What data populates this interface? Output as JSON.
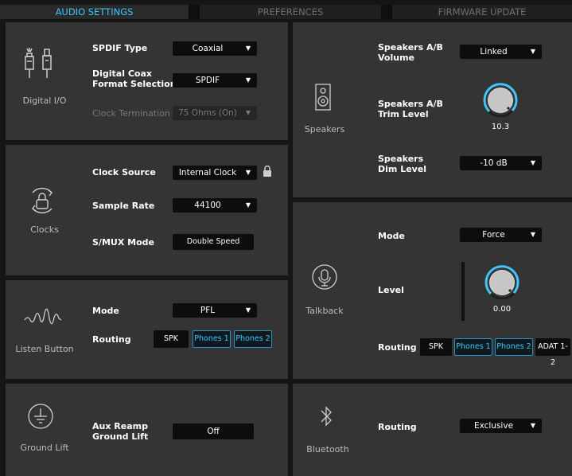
{
  "tabs": [
    {
      "label": "AUDIO SETTINGS",
      "active": true
    },
    {
      "label": "PREFERENCES",
      "active": false
    },
    {
      "label": "FIRMWARE UPDATE",
      "active": false
    }
  ],
  "digital_io": {
    "section_label": "Digital I/O",
    "spdif_type_label": "SPDIF Type",
    "spdif_type_value": "Coaxial",
    "coax_format_label": "Digital Coax\nFormat Selection",
    "coax_format_value": "SPDIF",
    "clock_termination_label": "Clock Termination",
    "clock_termination_value": "75 Ohms (On)"
  },
  "clocks": {
    "section_label": "Clocks",
    "clock_source_label": "Clock Source",
    "clock_source_value": "Internal Clock",
    "sample_rate_label": "Sample Rate",
    "sample_rate_value": "44100",
    "smux_label": "S/MUX Mode",
    "smux_value": "Double Speed"
  },
  "listen": {
    "section_label": "Listen Button",
    "mode_label": "Mode",
    "mode_value": "PFL",
    "routing_label": "Routing",
    "routing": [
      {
        "label": "SPK",
        "selected": false
      },
      {
        "label": "Phones 1",
        "selected": true
      },
      {
        "label": "Phones 2",
        "selected": true
      }
    ]
  },
  "ground": {
    "section_label": "Ground Lift",
    "aux_label": "Aux Reamp\nGround Lift",
    "aux_value": "Off"
  },
  "speakers": {
    "section_label": "Speakers",
    "ab_volume_label": "Speakers A/B\nVolume",
    "ab_volume_value": "Linked",
    "trim_label": "Speakers A/B\nTrim Level",
    "trim_value": "10.3",
    "dim_label": "Speakers\nDim Level",
    "dim_value": "-10 dB"
  },
  "talkback": {
    "section_label": "Talkback",
    "mode_label": "Mode",
    "mode_value": "Force",
    "level_label": "Level",
    "level_value": "0.00",
    "routing_label": "Routing",
    "routing": [
      {
        "label": "SPK",
        "selected": false
      },
      {
        "label": "Phones 1",
        "selected": true
      },
      {
        "label": "Phones 2",
        "selected": true
      },
      {
        "label": "ADAT 1-2",
        "selected": false
      }
    ]
  },
  "bluetooth": {
    "section_label": "Bluetooth",
    "routing_label": "Routing",
    "routing_value": "Exclusive"
  },
  "colors": {
    "accent": "#3fc6ff",
    "panel": "#343434",
    "background": "#161616"
  }
}
